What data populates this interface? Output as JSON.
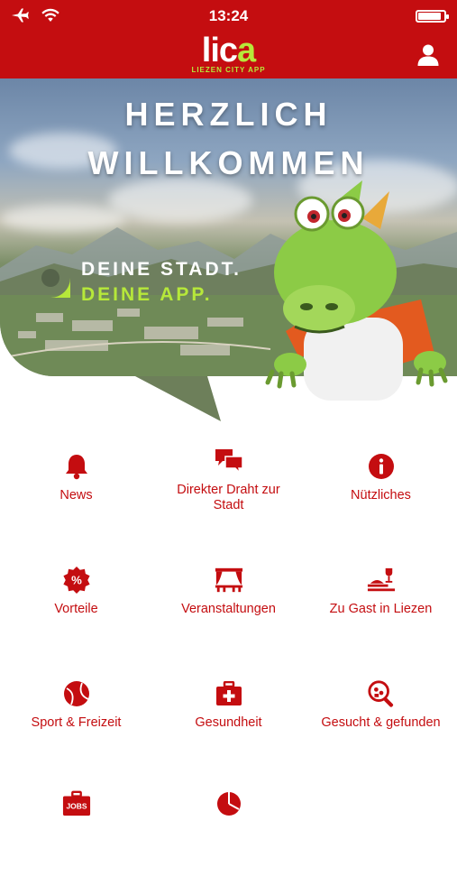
{
  "status_bar": {
    "time": "13:24",
    "battery_level": 0.9
  },
  "header": {
    "logo_text": "lica",
    "logo_subtitle": "LIEZEN CITY APP",
    "profile_icon": "user-icon"
  },
  "hero": {
    "title_line1": "HERZLICH",
    "title_line2": "WILLKOMMEN",
    "tagline_line1": "DEINE STADT.",
    "tagline_line2": "DEINE APP."
  },
  "tiles": [
    {
      "label": "News",
      "icon": "bell-icon"
    },
    {
      "label": "Direkter Draht zur Stadt",
      "icon": "chat-bubbles-icon"
    },
    {
      "label": "Nützliches",
      "icon": "info-icon"
    },
    {
      "label": "Vorteile",
      "icon": "percent-badge-icon"
    },
    {
      "label": "Veranstaltungen",
      "icon": "stage-icon"
    },
    {
      "label": "Zu Gast in Liezen",
      "icon": "dining-icon"
    },
    {
      "label": "Sport & Freizeit",
      "icon": "ball-icon"
    },
    {
      "label": "Gesundheit",
      "icon": "first-aid-kit-icon"
    },
    {
      "label": "Gesucht & gefunden",
      "icon": "magnifier-icon"
    },
    {
      "label": "",
      "icon": "jobs-icon"
    },
    {
      "label": "",
      "icon": "pie-chart-icon"
    }
  ],
  "colors": {
    "brand_red": "#c40d10",
    "accent_green": "#b6e83a"
  }
}
